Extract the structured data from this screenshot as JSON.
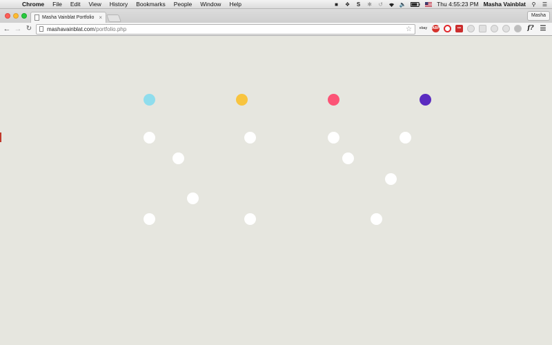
{
  "menubar": {
    "apple_icon": "apple-icon",
    "app_name": "Chrome",
    "menus": [
      "File",
      "Edit",
      "View",
      "History",
      "Bookmarks",
      "People",
      "Window",
      "Help"
    ],
    "clock": "Thu 4:55:23 PM",
    "user": "Masha Vainblat",
    "tray_icons": [
      "evernote-icon",
      "dropbox-icon",
      "skype-icon",
      "bluetooth-icon",
      "time-machine-icon",
      "wifi-icon",
      "volume-icon",
      "battery-icon",
      "flag-icon",
      "search-icon",
      "list-icon"
    ]
  },
  "browser": {
    "tab_title": "Masha Vainblat Portfolio",
    "tab_close": "×",
    "profile_label": "Masha",
    "url_host": "mashavainblat.com",
    "url_path": "/portfolio.php",
    "extensions": [
      "ebay-icon",
      "adblock-icon",
      "opera-icon",
      "lastpass-icon",
      "circle-icon",
      "download-icon",
      "pen-icon",
      "gray-circle-icon",
      "p-icon",
      "fq-icon",
      "menu-icon"
    ],
    "abp_label": "ABP",
    "lastpass_label": "•••",
    "fq_label": "f?",
    "ebay_label": "ebay"
  },
  "page": {
    "background": "#e6e6df",
    "accent_dots": [
      {
        "color": "#8fdded",
        "name": "cyan"
      },
      {
        "color": "#f8c43f",
        "name": "yellow"
      },
      {
        "color": "#fc5476",
        "name": "pink"
      },
      {
        "color": "#5a2bc0",
        "name": "purple"
      }
    ],
    "white_dot_count": 11
  }
}
